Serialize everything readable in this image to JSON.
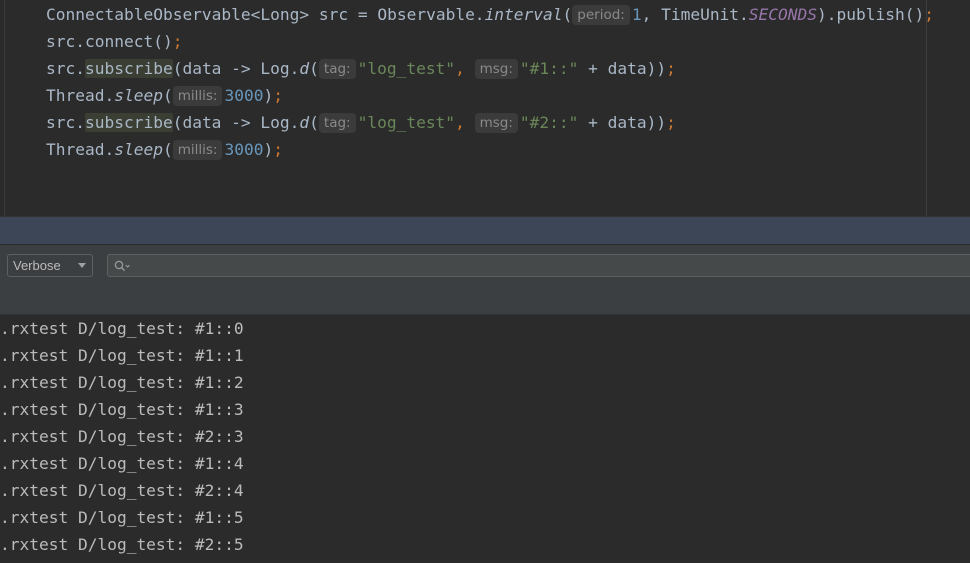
{
  "editor": {
    "lines": [
      {
        "a": "ConnectableObservable<Long> src = Observable.",
        "b": "interval",
        "c": "(",
        "hint": "period:",
        "num": "1",
        "d": ", TimeUnit.",
        "e": "SECONDS",
        "f": ").publish()",
        "semi": ";"
      },
      {
        "a": "src.connect()",
        "semi": ";"
      },
      {
        "a": "src.",
        "method": "subscribe",
        "b": "(data -> Log.",
        "fn": "d",
        "c": "(",
        "hint1": "tag:",
        "str1": "\"log_test\"",
        "comma": ",",
        "hint2": "msg:",
        "str2": "\"#1::\"",
        "tail": " + data))",
        "semi": ";"
      },
      {
        "a": "Thread.",
        "fn": "sleep",
        "b": "(",
        "hint": "millis:",
        "num": "3000",
        "c": ")",
        "semi": ";"
      },
      {
        "a": "src.",
        "method": "subscribe",
        "b": "(data -> Log.",
        "fn": "d",
        "c": "(",
        "hint1": "tag:",
        "str1": "\"log_test\"",
        "comma": ",",
        "hint2": "msg:",
        "str2": "\"#2::\"",
        "tail": " + data))",
        "semi": ";"
      },
      {
        "a": "Thread.",
        "fn": "sleep",
        "b": "(",
        "hint": "millis:",
        "num": "3000",
        "c": ")",
        "semi": ";"
      }
    ]
  },
  "logcat_toolbar": {
    "level": "Verbose",
    "search_placeholder": "",
    "search_value": ""
  },
  "logcat": {
    "lines": [
      ".rxtest D/log_test: #1::0",
      ".rxtest D/log_test: #1::1",
      ".rxtest D/log_test: #1::2",
      ".rxtest D/log_test: #1::3",
      ".rxtest D/log_test: #2::3",
      ".rxtest D/log_test: #1::4",
      ".rxtest D/log_test: #2::4",
      ".rxtest D/log_test: #1::5",
      ".rxtest D/log_test: #2::5"
    ]
  },
  "colors": {
    "background": "#2b2b2b",
    "keyword": "#cc7832",
    "string": "#6a8759",
    "number": "#6897bb",
    "constant": "#9876aa",
    "text": "#a9b7c6",
    "tool_header": "#3c4656"
  },
  "icons": {
    "search": "search-icon",
    "dropdown": "chevron-down-icon"
  }
}
